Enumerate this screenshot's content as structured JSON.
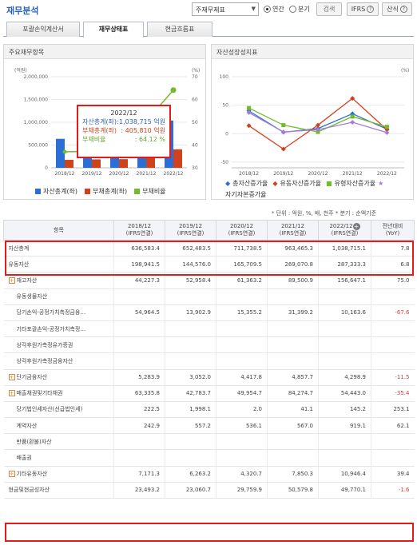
{
  "header": {
    "title": "재무분석",
    "statement_select": "주재무제표",
    "radio_annual": "연간",
    "radio_quarter": "분기",
    "search_label": "검색",
    "ifrs_label": "IFRS",
    "formula_label": "산식"
  },
  "tabs": [
    "포괄손익계산서",
    "재무상태표",
    "현금흐름표"
  ],
  "left_chart": {
    "title": "주요재무항목",
    "left_unit": "(억원)",
    "right_unit": "(%)",
    "yticks_left": [
      "2,000,000",
      "1,500,000",
      "1,000,000",
      "500,000",
      "0"
    ],
    "yticks_right": [
      "70",
      "60",
      "50",
      "40",
      "30"
    ],
    "legend": [
      "자산총계(좌)",
      "부채총계(좌)",
      "부채비율"
    ],
    "colors": [
      "#2b6fd6",
      "#d0421b",
      "#73bb2c"
    ]
  },
  "right_chart": {
    "title": "자산성장성지표",
    "unit": "(%)",
    "yticks": [
      "100",
      "50",
      "0",
      "-50"
    ],
    "legend": [
      "총자산증가율",
      "유동자산증가율",
      "유형자산증가율",
      "자기자본증가율"
    ],
    "colors": [
      "#2b6fd6",
      "#d0421b",
      "#73bb2c",
      "#a77ad8"
    ]
  },
  "chart_data": [
    {
      "type": "bar",
      "title": "주요재무항목",
      "categories": [
        "2018/12",
        "2019/12",
        "2020/12",
        "2021/12",
        "2022/12"
      ],
      "series": [
        {
          "name": "자산총계(좌)",
          "values": [
            636583.4,
            652483.5,
            711738.5,
            963465.3,
            1038715.1
          ]
        },
        {
          "name": "부채총계(좌)",
          "values": [
            175000,
            185000,
            190000,
            280000,
            405810
          ]
        },
        {
          "name": "부채비율",
          "values": [
            37.0,
            37.3,
            38.5,
            50.5,
            64.12
          ]
        }
      ],
      "ylim": [
        0,
        2000000
      ],
      "y2lim": [
        30,
        70
      ]
    },
    {
      "type": "line",
      "title": "자산성장성지표",
      "categories": [
        "2018/12",
        "2019/12",
        "2020/12",
        "2021/12",
        "2022/12"
      ],
      "series": [
        {
          "name": "총자산증가율",
          "values": [
            40,
            2.5,
            9,
            35,
            7.8
          ]
        },
        {
          "name": "유동자산증가율",
          "values": [
            14,
            -27,
            15,
            62,
            6.8
          ]
        },
        {
          "name": "유형자산증가율",
          "values": [
            45,
            15,
            3,
            30,
            12
          ]
        },
        {
          "name": "자기자본증가율",
          "values": [
            37,
            3,
            7,
            20,
            2
          ]
        }
      ],
      "ylim": [
        -60,
        100
      ]
    }
  ],
  "tooltip": {
    "date": "2022/12",
    "assets_label": "자산총계(좌)",
    "assets_value": ":1,038,715 억원",
    "liab_label": "부채총계(좌)",
    "liab_value": ": 405,810 억원",
    "ratio_label": "부채비율",
    "ratio_value": ":      64.12 %"
  },
  "unit_note": "* 단위 : 억원, %, 배, 천주   * 분기 : 순액기준",
  "table": {
    "headers": [
      {
        "l1": "항목",
        "l2": ""
      },
      {
        "l1": "2018/12",
        "l2": "(IFRS연결)"
      },
      {
        "l1": "2019/12",
        "l2": "(IFRS연결)"
      },
      {
        "l1": "2020/12",
        "l2": "(IFRS연결)"
      },
      {
        "l1": "2021/12",
        "l2": "(IFRS연결)"
      },
      {
        "l1": "2022/12",
        "l2": "(IFRS연결)"
      },
      {
        "l1": "전년대비",
        "l2": "(YoY)"
      }
    ],
    "rows": [
      {
        "label": "자산총계",
        "v": [
          "636,583.4",
          "652,483.5",
          "711,738.5",
          "963,465.3",
          "1,038,715.1",
          "7.8"
        ]
      },
      {
        "label": "유동자산",
        "v": [
          "198,941.5",
          "144,576.0",
          "165,709.5",
          "269,070.8",
          "287,333.3",
          "6.8"
        ]
      },
      {
        "label": "재고자산",
        "v": [
          "44,227.3",
          "52,958.4",
          "61,363.2",
          "89,500.9",
          "156,647.1",
          "75.0"
        ]
      },
      {
        "label": "유동생물자산",
        "v": [
          "",
          "",
          "",
          "",
          "",
          ""
        ]
      },
      {
        "label": "당기손익-공정가치측정금융…",
        "v": [
          "54,964.5",
          "13,902.9",
          "15,355.2",
          "31,399.2",
          "10,163.6",
          "-67.6"
        ]
      },
      {
        "label": "기타포괄손익-공정가치측정…",
        "v": [
          "",
          "",
          "",
          "",
          "",
          ""
        ]
      },
      {
        "label": "상각후원가측정유가증권",
        "v": [
          "",
          "",
          "",
          "",
          "",
          ""
        ]
      },
      {
        "label": "상각후원가측정금융자산",
        "v": [
          "",
          "",
          "",
          "",
          "",
          ""
        ]
      },
      {
        "label": "단기금융자산",
        "v": [
          "5,283.9",
          "3,052.0",
          "4,417.8",
          "4,857.7",
          "4,298.9",
          "-11.5"
        ]
      },
      {
        "label": "매출채권및기타채권",
        "v": [
          "63,335.8",
          "42,783.7",
          "49,954.7",
          "84,274.7",
          "54,443.0",
          "-35.4"
        ]
      },
      {
        "label": "당기법인세자산(선급법인세)",
        "v": [
          "222.5",
          "1,998.1",
          "2.0",
          "41.1",
          "145.2",
          "253.1"
        ]
      },
      {
        "label": "계약자산",
        "v": [
          "242.9",
          "557.2",
          "536.1",
          "567.0",
          "919.1",
          "62.1"
        ]
      },
      {
        "label": "반품(환불)자산",
        "v": [
          "",
          "",
          "",
          "",
          "",
          ""
        ]
      },
      {
        "label": "배출권",
        "v": [
          "",
          "",
          "",
          "",
          "",
          ""
        ]
      },
      {
        "label": "기타유동자산",
        "v": [
          "7,171.3",
          "6,263.2",
          "4,320.7",
          "7,850.3",
          "10,946.4",
          "39.4"
        ]
      },
      {
        "label": "현금및현금성자산",
        "v": [
          "23,493.2",
          "23,060.7",
          "29,759.9",
          "50,579.8",
          "49,770.1",
          "-1.6"
        ]
      }
    ]
  }
}
